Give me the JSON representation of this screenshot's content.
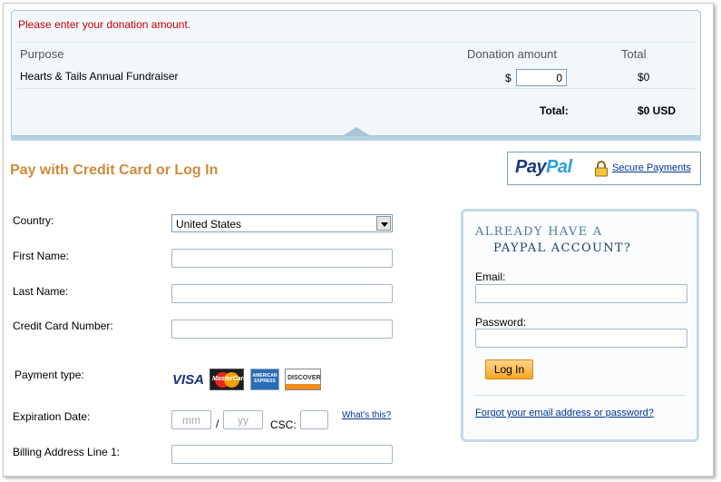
{
  "summary": {
    "error": "Please enter your donation amount.",
    "headers": {
      "purpose": "Purpose",
      "donation_amount": "Donation amount",
      "total": "Total"
    },
    "row": {
      "purpose": "Hearts & Tails Annual Fundraiser",
      "currency_symbol": "$",
      "amount_value": "0",
      "total": "$0"
    },
    "footer": {
      "label": "Total:",
      "value": "$0 USD"
    }
  },
  "header": {
    "title": "Pay with Credit Card or Log In",
    "paypal_logo_part1": "Pay",
    "paypal_logo_part2": "Pal",
    "secure_payments": "Secure Payments"
  },
  "form": {
    "country_label": "Country:",
    "country_value": "United States",
    "first_name_label": "First Name:",
    "last_name_label": "Last Name:",
    "card_number_label": "Credit Card Number:",
    "payment_type_label": "Payment type:",
    "card_brands": [
      "VISA",
      "MasterCard",
      "AMERICAN EXPRESS",
      "DISCOVER"
    ],
    "expiration_label": "Expiration Date:",
    "mm_placeholder": "mm",
    "yy_placeholder": "yy",
    "slash": "/",
    "csc_label": "CSC:",
    "whats_this": "What's this?",
    "billing_label": "Billing Address Line 1:"
  },
  "login": {
    "heading_line1": "ALREADY HAVE A",
    "heading_line2": "PAYPAL ACCOUNT?",
    "email_label": "Email:",
    "password_label": "Password:",
    "login_button": "Log In",
    "forgot_link": "Forgot your email address or password?"
  },
  "colors": {
    "error": "#cc0000",
    "title": "#d08a38",
    "link": "#003399",
    "paypal_dark": "#1a3a7c",
    "paypal_light": "#2aa1de",
    "button": "#f6a623"
  }
}
